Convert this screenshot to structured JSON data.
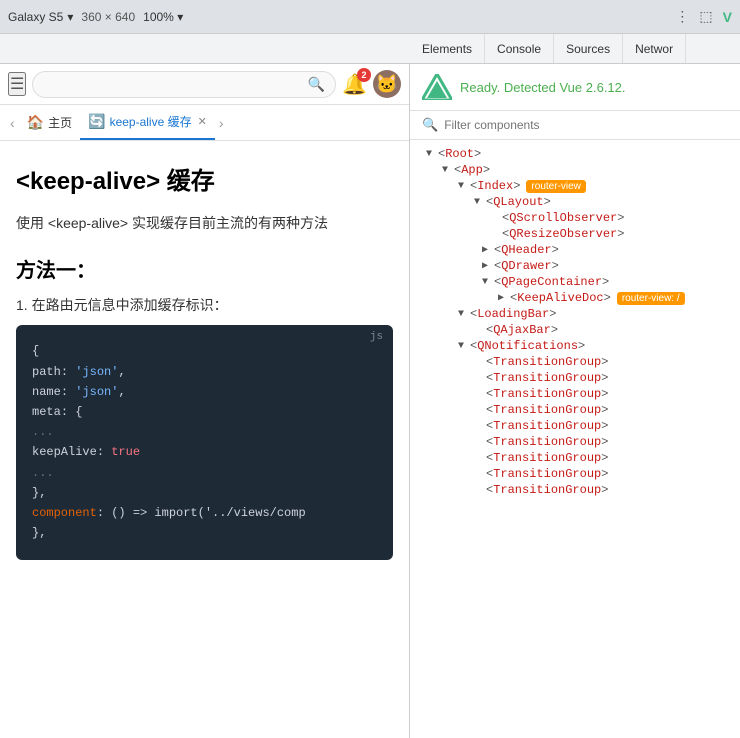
{
  "browser": {
    "device": "Galaxy S5",
    "width": "360",
    "height": "640",
    "zoom": "100%",
    "more_icon": "⋮"
  },
  "devtools_tabs": [
    {
      "label": "Elements",
      "active": false
    },
    {
      "label": "Console",
      "active": false
    },
    {
      "label": "Sources",
      "active": false
    },
    {
      "label": "Networ",
      "active": false
    }
  ],
  "mobile_browser": {
    "search_placeholder": "",
    "notif_count": "2",
    "tabs": [
      {
        "label": "主页",
        "icon": "🏠",
        "active": false,
        "closeable": false
      },
      {
        "label": "keep-alive 缓存",
        "icon": "🔄",
        "active": true,
        "closeable": true
      }
    ]
  },
  "page_content": {
    "title": "<keep-alive> 缓存",
    "description": "使用 <keep-alive> 实现缓存目前主流的有两种方法",
    "section1_title": "方法一：",
    "step1": "1. 在路由元信息中添加缓存标识：",
    "code_lang": "js",
    "code_lines": [
      {
        "type": "plain",
        "text": "{"
      },
      {
        "type": "mixed",
        "parts": [
          {
            "class": "code-plain",
            "text": "  path"
          },
          {
            "class": "code-plain",
            "text": ": "
          },
          {
            "class": "code-string",
            "text": "'json'"
          },
          {
            "class": "code-plain",
            "text": ","
          }
        ]
      },
      {
        "type": "mixed",
        "parts": [
          {
            "class": "code-plain",
            "text": "  name"
          },
          {
            "class": "code-plain",
            "text": ": "
          },
          {
            "class": "code-string",
            "text": "'json'"
          },
          {
            "class": "code-plain",
            "text": ","
          }
        ]
      },
      {
        "type": "mixed",
        "parts": [
          {
            "class": "code-plain",
            "text": "  meta"
          },
          {
            "class": "code-plain",
            "text": ": {"
          }
        ]
      },
      {
        "type": "comment",
        "text": "    ..."
      },
      {
        "type": "mixed",
        "parts": [
          {
            "class": "code-plain",
            "text": "    keepAlive"
          },
          {
            "class": "code-plain",
            "text": ": "
          },
          {
            "class": "code-bool",
            "text": "true"
          }
        ]
      },
      {
        "type": "comment",
        "text": "    ..."
      },
      {
        "type": "plain",
        "text": "  },"
      },
      {
        "type": "mixed",
        "parts": [
          {
            "class": "code-keyword",
            "text": "  component"
          },
          {
            "class": "code-plain",
            "text": ": () => import('../views/comp"
          }
        ]
      },
      {
        "type": "plain",
        "text": "},"
      }
    ]
  },
  "vue_devtools": {
    "logo_color": "#41b883",
    "status": "Ready. Detected Vue 2.6.12.",
    "filter_placeholder": "Filter components",
    "tree": [
      {
        "level": 0,
        "arrow": "down",
        "name": "Root",
        "badge": null
      },
      {
        "level": 1,
        "arrow": "down",
        "name": "App",
        "badge": null
      },
      {
        "level": 2,
        "arrow": "down",
        "name": "Index",
        "badge": "router-view"
      },
      {
        "level": 3,
        "arrow": "down",
        "name": "QLayout",
        "badge": null
      },
      {
        "level": 4,
        "arrow": "none",
        "name": "QScrollObserver",
        "badge": null
      },
      {
        "level": 4,
        "arrow": "none",
        "name": "QResizeObserver",
        "badge": null
      },
      {
        "level": 4,
        "arrow": "right",
        "name": "QHeader",
        "badge": null
      },
      {
        "level": 4,
        "arrow": "right",
        "name": "QDrawer",
        "badge": null
      },
      {
        "level": 4,
        "arrow": "down",
        "name": "QPageContainer",
        "badge": null
      },
      {
        "level": 5,
        "arrow": "right",
        "name": "KeepAliveDoc",
        "badge": "router-view: /"
      },
      {
        "level": 2,
        "arrow": "down",
        "name": "LoadingBar",
        "badge": null
      },
      {
        "level": 3,
        "arrow": "none",
        "name": "QAjaxBar",
        "badge": null
      },
      {
        "level": 2,
        "arrow": "down",
        "name": "QNotifications",
        "badge": null
      },
      {
        "level": 3,
        "arrow": "none",
        "name": "TransitionGroup",
        "badge": null
      },
      {
        "level": 3,
        "arrow": "none",
        "name": "TransitionGroup",
        "badge": null
      },
      {
        "level": 3,
        "arrow": "none",
        "name": "TransitionGroup",
        "badge": null
      },
      {
        "level": 3,
        "arrow": "none",
        "name": "TransitionGroup",
        "badge": null
      },
      {
        "level": 3,
        "arrow": "none",
        "name": "TransitionGroup",
        "badge": null
      },
      {
        "level": 3,
        "arrow": "none",
        "name": "TransitionGroup",
        "badge": null
      },
      {
        "level": 3,
        "arrow": "none",
        "name": "TransitionGroup",
        "badge": null
      },
      {
        "level": 3,
        "arrow": "none",
        "name": "TransitionGroup",
        "badge": null
      },
      {
        "level": 3,
        "arrow": "none",
        "name": "TransitionGroup",
        "badge": null
      }
    ]
  }
}
